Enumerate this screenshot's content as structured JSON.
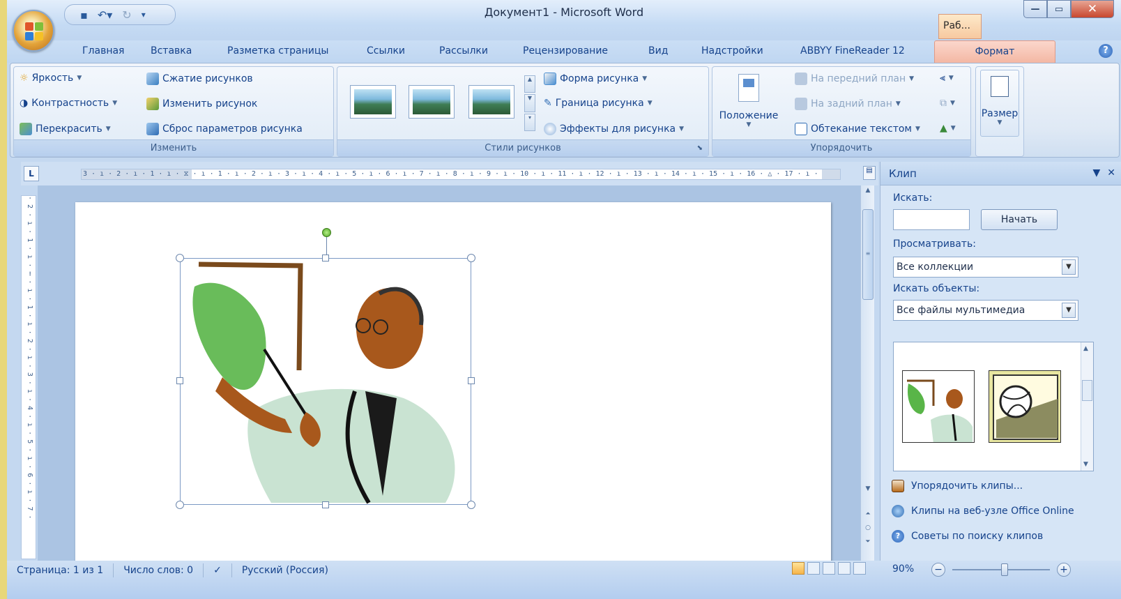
{
  "window": {
    "title": "Документ1 - Microsoft Word",
    "tab_hint": "Раб..."
  },
  "tabs": [
    "Главная",
    "Вставка",
    "Разметка страницы",
    "Ссылки",
    "Рассылки",
    "Рецензирование",
    "Вид",
    "Надстройки",
    "ABBYY FineReader 12"
  ],
  "active_tab": "Формат",
  "groups": {
    "change": {
      "label": "Изменить",
      "brightness": "Яркость",
      "contrast": "Контрастность",
      "recolor": "Перекрасить",
      "compress": "Сжатие рисунков",
      "change_picture": "Изменить рисунок",
      "reset": "Сброс параметров рисунка"
    },
    "styles": {
      "label": "Стили рисунков",
      "shape": "Форма рисунка",
      "border": "Граница рисунка",
      "effects": "Эффекты для рисунка"
    },
    "arrange": {
      "label": "Упорядочить",
      "position": "Положение",
      "bring_front": "На передний план",
      "send_back": "На задний план",
      "wrap": "Обтекание текстом"
    },
    "size": {
      "label": "Размер"
    }
  },
  "ruler": {
    "h_text": "3 · ı · 2 · ı · 1 · ı · ⧖ · ı · 1 · ı · 2 · ı · 3 · ı · 4 · ı · 5 · ı · 6 · ı · 7 · ı · 8 · ı · 9 · ı · 10 · ı · 11 · ı · 12 · ı · 13 · ı · 14 · ı · 15 · ı · 16 · △ · 17 · ı ·",
    "v_text": "· 2 · ı · 1 · ı · ⋯ · ı · 1 · ı · 2 · ı · 3 · ı · 4 · ı · 5 · ı · 6 · ı · 7 ·"
  },
  "pane": {
    "title": "Клип",
    "search_label": "Искать:",
    "search_value": "",
    "start_button": "Начать",
    "browse_label": "Просматривать:",
    "browse_value": "Все коллекции",
    "objects_label": "Искать объекты:",
    "objects_value": "Все файлы мультимедиа",
    "link_organize": "Упорядочить клипы...",
    "link_online": "Клипы на веб-узле Office Online",
    "link_tips": "Советы по поиску клипов"
  },
  "status": {
    "page": "Страница: 1 из 1",
    "words": "Число слов: 0",
    "language": "Русский (Россия)",
    "zoom": "90%"
  },
  "colors": {
    "ribbon_bg": "#dfe9f5",
    "accent_format_tab": "#f3b5a1",
    "title_text": "#15428b"
  }
}
